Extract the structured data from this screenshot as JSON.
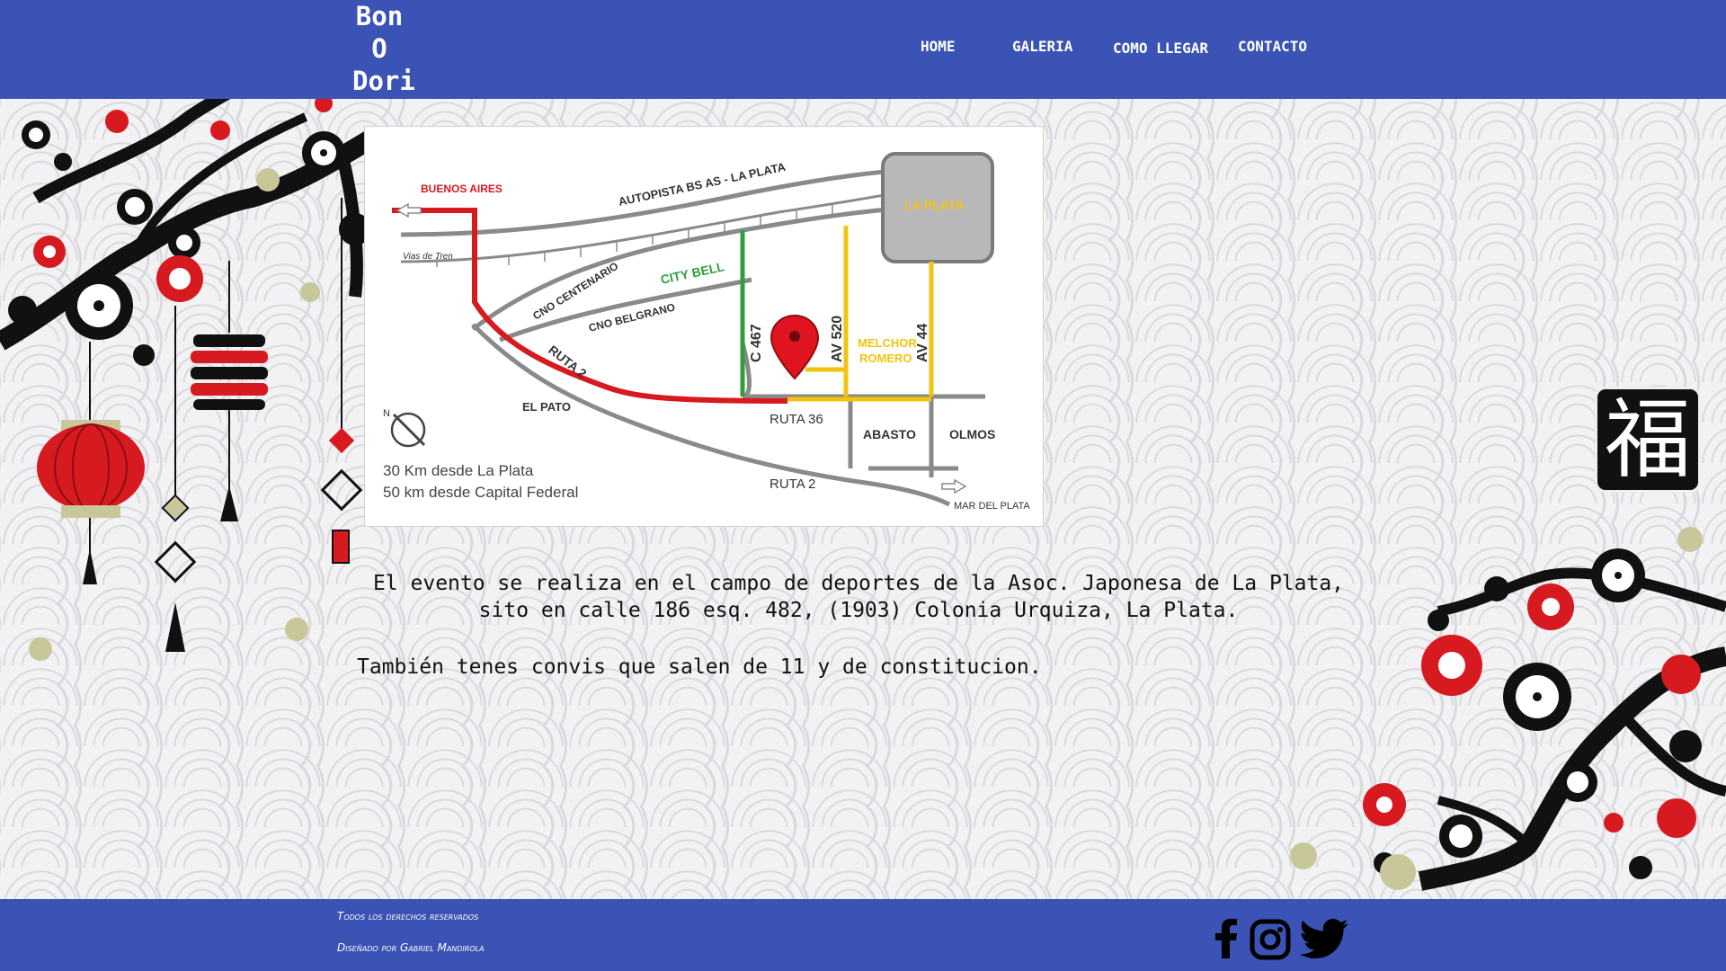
{
  "brand": {
    "line1": "Bon",
    "line2": "O",
    "line3": "Dori"
  },
  "nav": {
    "items": [
      "HOME",
      "GALERIA",
      "COMO LLEGAR",
      "CONTACTO"
    ]
  },
  "map": {
    "labels": {
      "buenos_aires": "BUENOS AIRES",
      "autopista": "AUTOPISTA BS AS - LA PLATA",
      "la_plata": "LA PLATA",
      "vias": "Vias de Tren",
      "cno_centenario": "CNO CENTENARIO",
      "city_bell": "CITY BELL",
      "cno_belgrano": "CNO BELGRANO",
      "c467": "C 467",
      "av520": "AV 520",
      "av44": "AV 44",
      "melchor": "MELCHOR",
      "romero": "ROMERO",
      "ruta2_diag": "RUTA 2",
      "el_pato": "EL PATO",
      "ruta36": "RUTA 36",
      "abasto": "ABASTO",
      "olmos": "OLMOS",
      "ruta2": "RUTA 2",
      "north": "N",
      "dist1": "30 Km desde La Plata",
      "dist2": "50 km desde Capital Federal",
      "mar_del_plata": "MAR DEL PLATA"
    },
    "colors": {
      "route": "#d71920",
      "green": "#2e9e3e",
      "yellow": "#f2c40f",
      "road": "#8a8a8a",
      "pin": "#e0141e"
    }
  },
  "content": {
    "event_line1": "El evento se realiza en el campo de deportes de la Asoc. Japonesa de La Plata,",
    "event_line2": "sito en calle 186 esq. 482, (1903) Colonia Urquiza, La Plata.",
    "convis": "También tenes convis que salen de 11 y de constitucion."
  },
  "badge": {
    "glyph": "福"
  },
  "footer": {
    "rights": "Todos los derechos reservados",
    "designer": "Diseñado por Gabriel Mandirola"
  },
  "social": {
    "icons": [
      "facebook-icon",
      "instagram-icon",
      "twitter-icon"
    ]
  },
  "colors": {
    "header_bg": "#3a53b4",
    "footer_bg": "#3a53b4",
    "text": "#111111"
  }
}
